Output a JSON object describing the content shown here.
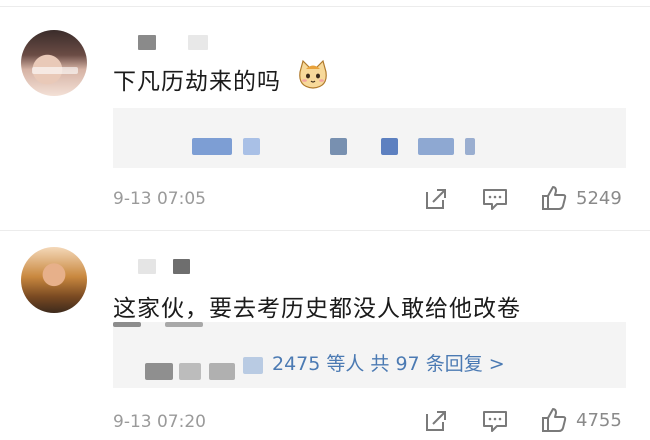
{
  "comments": [
    {
      "text": "下凡历劫来的吗",
      "emoji": "cat-face-icon",
      "time": "9-13 07:05",
      "likes": "5249"
    },
    {
      "text": "这家伙，要去考历史都没人敢给他改卷",
      "time": "9-13 07:20",
      "likes": "4755",
      "replies_text": "2475 等人  共 97 条回复 >"
    }
  ],
  "icons": [
    "share-icon",
    "comment-icon",
    "thumbs-up-icon"
  ],
  "colors": {
    "text": "#1b1b1b",
    "meta": "#9a9a9a",
    "link": "#4b7ab3",
    "quote_bg": "#f4f4f4"
  }
}
